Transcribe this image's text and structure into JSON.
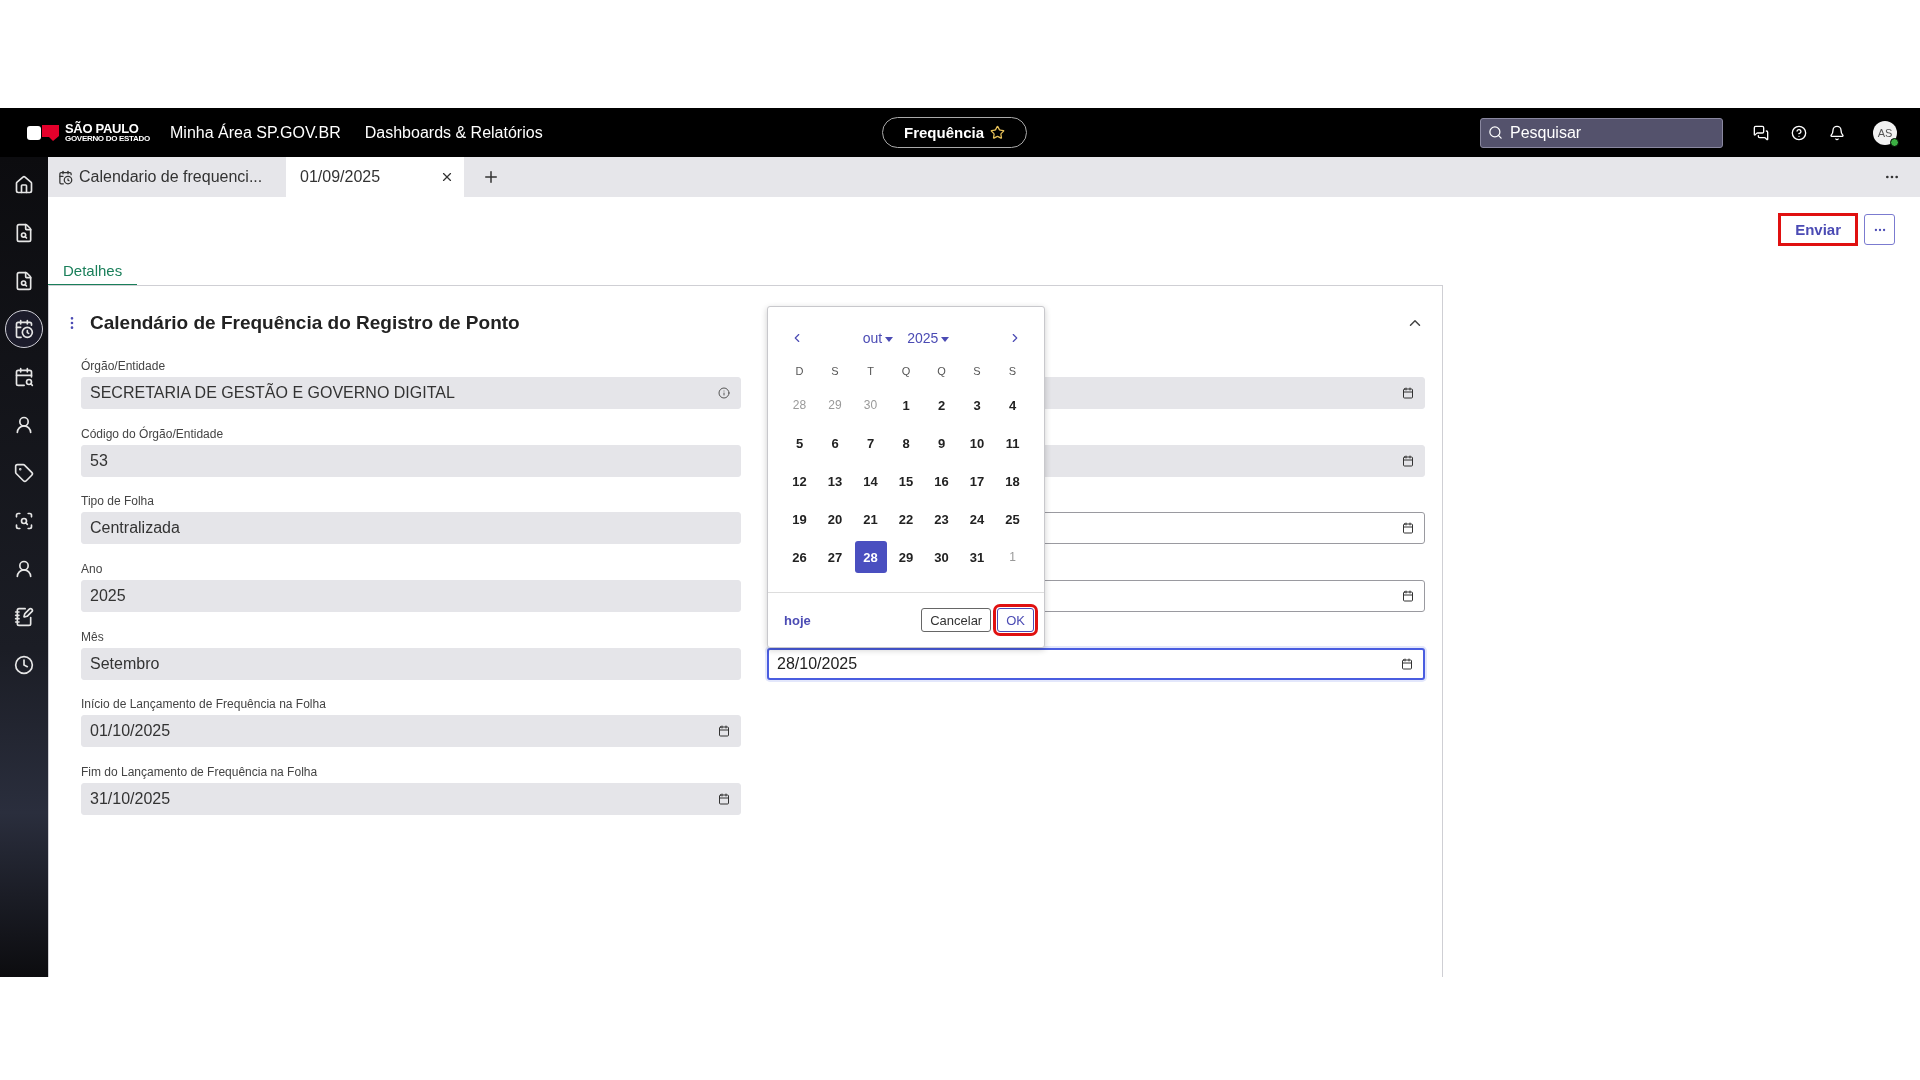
{
  "header": {
    "logo_name": "SÃO PAULO",
    "logo_sub": "GOVERNO DO ESTADO",
    "nav_links": [
      "Minha Área SP.GOV.BR",
      "Dashboards & Relatórios"
    ],
    "app_button": "Frequência",
    "search": {
      "placeholder": "Pesquisar"
    },
    "avatar": "AS"
  },
  "sidebar": {
    "items": [
      {
        "selected": false
      },
      {
        "selected": false
      },
      {
        "selected": false
      },
      {
        "selected": true
      },
      {
        "selected": false
      },
      {
        "selected": false
      },
      {
        "selected": false
      },
      {
        "selected": false
      },
      {
        "selected": false
      },
      {
        "selected": false
      },
      {
        "selected": false
      }
    ]
  },
  "tabs": [
    {
      "label": "Calendario de frequenci...",
      "selected": false
    },
    {
      "label": "01/09/2025",
      "selected": true
    }
  ],
  "actions": [
    {
      "label": "Enviar",
      "highlighted": true
    }
  ],
  "section_tabs": [
    {
      "label": "Detalhes",
      "selected": true
    }
  ],
  "card": {
    "title": "Calendário de Frequência do Registro de Ponto",
    "expanded": true
  },
  "left_fields": [
    {
      "label": "Órgão/Entidade",
      "value": "SECRETARIA DE GESTÃO E GOVERNO DIGITAL",
      "disabled": true,
      "kind": "info"
    },
    {
      "label": "Código do Órgão/Entidade",
      "value": "53",
      "disabled": true,
      "kind": "text"
    },
    {
      "label": "Tipo de Folha",
      "value": "Centralizada",
      "disabled": true,
      "kind": "text"
    },
    {
      "label": "Ano",
      "value": "2025",
      "disabled": true,
      "kind": "text"
    },
    {
      "label": "Mês",
      "value": "Setembro",
      "disabled": true,
      "kind": "text"
    },
    {
      "label": "Início de Lançamento de Frequência na Folha",
      "value": "01/10/2025",
      "disabled": true,
      "kind": "date"
    },
    {
      "label": "Fim do Lançamento de Frequência na Folha",
      "value": "31/10/2025",
      "disabled": true,
      "kind": "date"
    }
  ],
  "right_fields": [
    {
      "disabled": true,
      "focused": false
    },
    {
      "disabled": true,
      "focused": false
    },
    {
      "disabled": false,
      "focused": false
    },
    {
      "disabled": false,
      "focused": false
    },
    {
      "value": "28/10/2025",
      "disabled": false,
      "focused": true
    }
  ],
  "date_picker": {
    "month": "out",
    "year": "2025",
    "weekdays": [
      "D",
      "S",
      "T",
      "Q",
      "Q",
      "S",
      "S"
    ],
    "days": [
      {
        "label": "28",
        "outside": true,
        "selected": false
      },
      {
        "label": "29",
        "outside": true,
        "selected": false
      },
      {
        "label": "30",
        "outside": true,
        "selected": false
      },
      {
        "label": "1",
        "outside": false,
        "selected": false
      },
      {
        "label": "2",
        "outside": false,
        "selected": false
      },
      {
        "label": "3",
        "outside": false,
        "selected": false
      },
      {
        "label": "4",
        "outside": false,
        "selected": false
      },
      {
        "label": "5",
        "outside": false,
        "selected": false
      },
      {
        "label": "6",
        "outside": false,
        "selected": false
      },
      {
        "label": "7",
        "outside": false,
        "selected": false
      },
      {
        "label": "8",
        "outside": false,
        "selected": false
      },
      {
        "label": "9",
        "outside": false,
        "selected": false
      },
      {
        "label": "10",
        "outside": false,
        "selected": false
      },
      {
        "label": "11",
        "outside": false,
        "selected": false
      },
      {
        "label": "12",
        "outside": false,
        "selected": false
      },
      {
        "label": "13",
        "outside": false,
        "selected": false
      },
      {
        "label": "14",
        "outside": false,
        "selected": false
      },
      {
        "label": "15",
        "outside": false,
        "selected": false
      },
      {
        "label": "16",
        "outside": false,
        "selected": false
      },
      {
        "label": "17",
        "outside": false,
        "selected": false
      },
      {
        "label": "18",
        "outside": false,
        "selected": false
      },
      {
        "label": "19",
        "outside": false,
        "selected": false
      },
      {
        "label": "20",
        "outside": false,
        "selected": false
      },
      {
        "label": "21",
        "outside": false,
        "selected": false
      },
      {
        "label": "22",
        "outside": false,
        "selected": false
      },
      {
        "label": "23",
        "outside": false,
        "selected": false
      },
      {
        "label": "24",
        "outside": false,
        "selected": false
      },
      {
        "label": "25",
        "outside": false,
        "selected": false
      },
      {
        "label": "26",
        "outside": false,
        "selected": false
      },
      {
        "label": "27",
        "outside": false,
        "selected": false
      },
      {
        "label": "28",
        "outside": false,
        "selected": true
      },
      {
        "label": "29",
        "outside": false,
        "selected": false
      },
      {
        "label": "30",
        "outside": false,
        "selected": false
      },
      {
        "label": "31",
        "outside": false,
        "selected": false
      },
      {
        "label": "1",
        "outside": true,
        "selected": false
      }
    ],
    "today": "hoje",
    "buttons": [
      {
        "label": "Cancelar",
        "kind": "secondary",
        "highlighted": false
      },
      {
        "label": "OK",
        "kind": "primary",
        "highlighted": true
      }
    ]
  }
}
